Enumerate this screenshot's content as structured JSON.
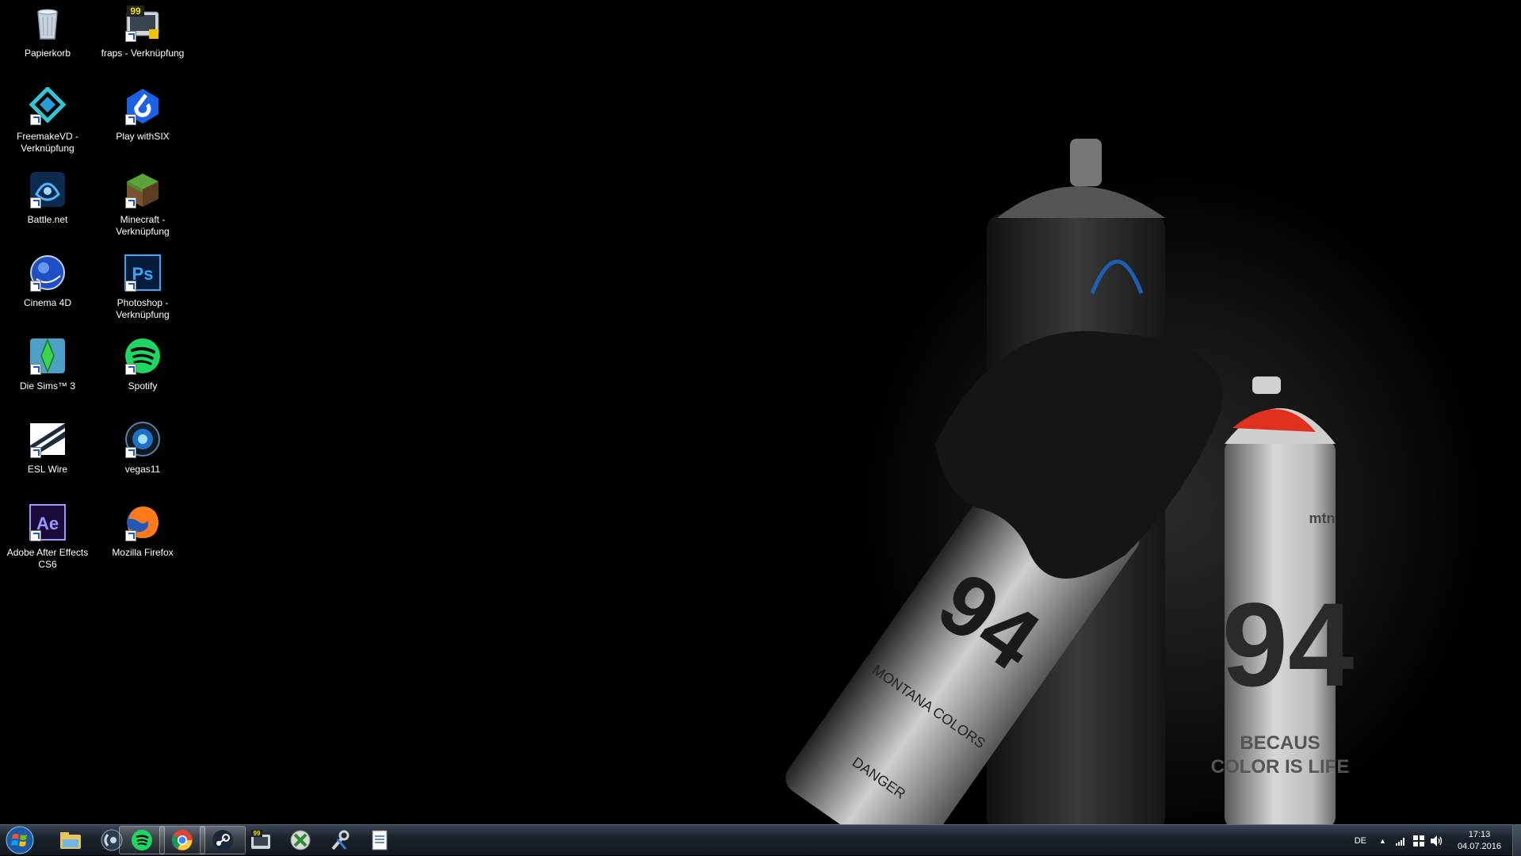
{
  "desktop": {
    "icons": [
      {
        "label": "Papierkorb",
        "icon": "recycle-bin-icon"
      },
      {
        "label": "fraps - Verknüpfung",
        "icon": "fraps-icon"
      },
      {
        "label": "FreemakeVD - Verknüpfung",
        "icon": "freemake-icon"
      },
      {
        "label": "Play withSIX",
        "icon": "playwithsix-icon"
      },
      {
        "label": "Battle.net",
        "icon": "battlenet-icon"
      },
      {
        "label": "Minecraft - Verknüpfung",
        "icon": "minecraft-icon"
      },
      {
        "label": "Cinema 4D",
        "icon": "cinema4d-icon"
      },
      {
        "label": "Photoshop - Verknüpfung",
        "icon": "photoshop-icon"
      },
      {
        "label": "Die Sims™ 3",
        "icon": "sims3-icon"
      },
      {
        "label": "Spotify",
        "icon": "spotify-icon"
      },
      {
        "label": "ESL Wire",
        "icon": "eslwire-icon"
      },
      {
        "label": "vegas11",
        "icon": "vegas-icon"
      },
      {
        "label": "Adobe After Effects CS6",
        "icon": "aftereffects-icon"
      },
      {
        "label": "Mozilla Firefox",
        "icon": "firefox-icon"
      }
    ],
    "fraps_badge": "99",
    "photoshop_text": "Ps",
    "aftereffects_text": "Ae"
  },
  "wallpaper": {
    "can_number": "94",
    "can_text_line1": "BECAUS",
    "can_text_line2": "COLOR IS LIFE",
    "brand": "mtn",
    "label_text": "MONTANA COLORS",
    "danger_text": "DANGER"
  },
  "taskbar": {
    "pinned": [
      {
        "icon": "explorer-icon",
        "active": false
      },
      {
        "icon": "steam-chat-icon",
        "active": false
      },
      {
        "icon": "spotify-icon",
        "active": true
      },
      {
        "icon": "chrome-icon",
        "active": true
      },
      {
        "icon": "steam-icon",
        "active": true
      },
      {
        "icon": "fraps-icon",
        "active": false
      },
      {
        "icon": "xbox-icon",
        "active": false
      },
      {
        "icon": "tools-icon",
        "active": false
      },
      {
        "icon": "notepad-icon",
        "active": false
      }
    ],
    "tray": {
      "language": "DE",
      "time": "17:13",
      "date": "04.07.2016"
    }
  },
  "colors": {
    "taskbar": "#1b222c",
    "spotify_green": "#1ed760",
    "photoshop_blue": "#31a8ff",
    "aftereffects_purple": "#9999ff",
    "spray_cap_red": "#e0301e"
  }
}
